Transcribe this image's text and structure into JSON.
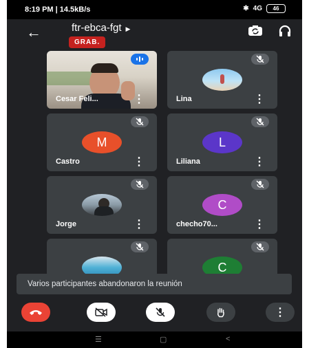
{
  "status": {
    "time_info": "8:19 PM | 14.5kB/s",
    "signal": "4G",
    "battery": "46"
  },
  "header": {
    "meeting_code": "ftr-ebca-fgt",
    "recording_badge": "GRAB."
  },
  "participants": [
    {
      "name": "Cesar Feli...",
      "avatar_type": "video"
    },
    {
      "name": "Lina",
      "avatar_type": "photo",
      "avatar_desc": "beach-photo"
    },
    {
      "name": "Castro",
      "avatar_type": "letter",
      "letter": "M",
      "color": "#e8502a"
    },
    {
      "name": "Liliana",
      "avatar_type": "letter",
      "letter": "L",
      "color": "#5b36c9"
    },
    {
      "name": "Jorge",
      "avatar_type": "photo",
      "avatar_desc": "person-photo"
    },
    {
      "name": "checho70...",
      "avatar_type": "letter",
      "letter": "C",
      "color": "#b04cc7"
    },
    {
      "name": "",
      "avatar_type": "photo",
      "avatar_desc": "pool-photo"
    },
    {
      "name": "",
      "avatar_type": "letter",
      "letter": "C",
      "color": "#1e7e34"
    }
  ],
  "toast": {
    "message": "Varios participantes abandonaron la reunión"
  },
  "controls": {
    "end_call_color": "#ea4335"
  },
  "icons": [
    "back-arrow-icon",
    "camera-switch-icon",
    "headphones-icon",
    "mic-off-icon",
    "speaking-icon",
    "more-icon",
    "end-call-icon",
    "camera-off-icon",
    "hand-raise-icon",
    "home-nav-icon",
    "back-nav-icon",
    "recents-nav-icon"
  ]
}
